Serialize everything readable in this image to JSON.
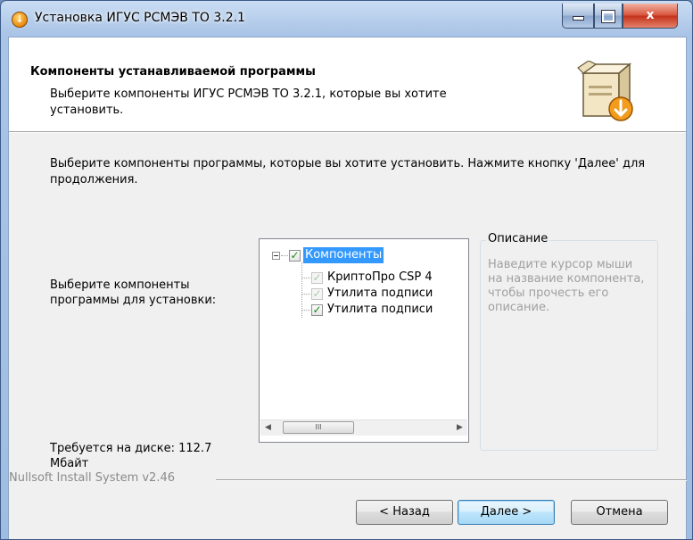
{
  "window": {
    "title": "Установка ИГУС РСМЭВ ТО 3.2.1",
    "icon": "installer-icon",
    "controls": {
      "minimize": "minimize-icon",
      "maximize": "maximize-icon",
      "close": "x"
    }
  },
  "header": {
    "title": "Компоненты устанавливаемой программы",
    "subtitle": "Выберите компоненты ИГУС РСМЭВ ТО 3.2.1, которые вы хотите установить.",
    "icon": "package-box-icon"
  },
  "body": {
    "intro": "Выберите компоненты программы, которые вы хотите установить. Нажмите кнопку 'Далее' для продолжения.",
    "select_label": "Выберите компоненты программы для установки:",
    "disk_label": "Требуется на диске: 112.7 Мбайт"
  },
  "tree": {
    "root": {
      "label": "Компоненты",
      "checked": true,
      "selected": true
    },
    "items": [
      {
        "label": "КриптоПро CSP 4",
        "checked": true,
        "disabled": true
      },
      {
        "label": "Утилита подписи",
        "checked": true,
        "disabled": true
      },
      {
        "label": "Утилита подписи",
        "checked": true,
        "disabled": false
      }
    ],
    "scrollbar": {
      "thumb_grip": "III"
    }
  },
  "description": {
    "legend": "Описание",
    "text": "Наведите курсор мыши на название компонента, чтобы прочесть его описание."
  },
  "footer": {
    "brand": "Nullsoft Install System v2.46",
    "back_label": "< Назад",
    "next_label": "Далее >",
    "cancel_label": "Отмена"
  },
  "colors": {
    "selection": "#3399ff",
    "check_green": "#1a8a1a",
    "title_bar": "#a9c4e6",
    "close_button": "#c2301a"
  }
}
